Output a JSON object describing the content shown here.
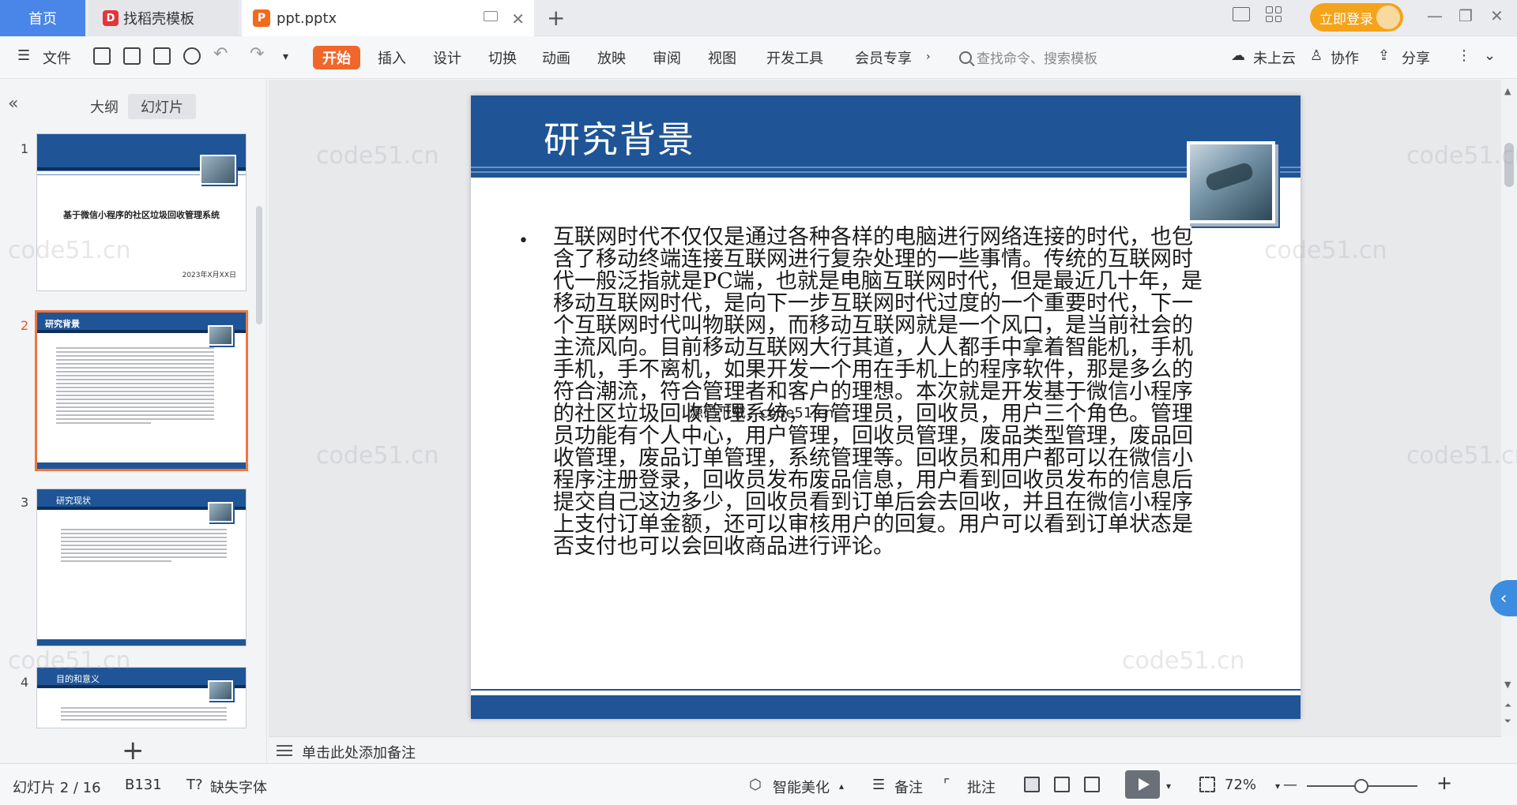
{
  "tabs": {
    "home": "首页",
    "docer": "找稻壳模板",
    "file": "ppt.pptx",
    "login": "立即登录"
  },
  "menu": {
    "file": "文件",
    "items": [
      "开始",
      "插入",
      "设计",
      "切换",
      "动画",
      "放映",
      "审阅",
      "视图",
      "开发工具",
      "会员专享"
    ],
    "search_placeholder": "查找命令、搜索模板",
    "cloud": "未上云",
    "collab": "协作",
    "share": "分享"
  },
  "leftpanel": {
    "view_tabs": [
      "大纲",
      "幻灯片"
    ],
    "active_view": "幻灯片",
    "thumbnails": [
      {
        "num": "1",
        "title": "基于微信小程序的社区垃圾回收管理系统",
        "date": "2023年X月XX日"
      },
      {
        "num": "2",
        "title": "研究背景"
      },
      {
        "num": "3",
        "title": "研究现状"
      },
      {
        "num": "4",
        "title": "目的和意义"
      }
    ],
    "selected": "2"
  },
  "slide": {
    "title": "研究背景",
    "body": "互联网时代不仅仅是通过各种各样的电脑进行网络连接的时代，也包含了移动终端连接互联网进行复杂处理的一些事情。传统的互联网时代一般泛指就是PC端，也就是电脑互联网时代，但是最近几十年，是移动互联网时代，是向下一步互联网时代过度的一个重要时代，下一个互联网时代叫物联网，而移动互联网就是一个风口，是当前社会的主流风向。目前移动互联网大行其道，人人都手中拿着智能机，手机手机，手不离机，如果开发一个用在手机上的程序软件，那是多么的符合潮流，符合管理者和客户的理想。本次就是开发基于微信小程序的社区垃圾回收管理系统，有管理员，回收员，用户三个角色。管理员功能有个人中心，用户管理，回收员管理，废品类型管理，废品回收管理，废品订单管理，系统管理等。回收员和用户都可以在微信小程序注册登录，回收员发布废品信息，用户看到回收员发布的信息后提交自己这边多少，回收员看到订单后会去回收，并且在微信小程序上支付订单金额，还可以审核用户的回复。用户可以看到订单状态是否支付也可以会回收商品进行评论。",
    "overlay": "源码下载：code51.cn"
  },
  "notes": {
    "placeholder": "单击此处添加备注"
  },
  "status": {
    "slide_counter": "幻灯片 2 / 16",
    "code": "B131",
    "missing_font": "缺失字体",
    "beautify": "智能美化",
    "notes": "备注",
    "comments": "批注",
    "zoom": "72%"
  },
  "watermark": "code51.cn",
  "colors": {
    "accent": "#f0662b",
    "slide_blue": "#1f5596",
    "login": "#f4a31b",
    "home_tab": "#4a86e8"
  }
}
